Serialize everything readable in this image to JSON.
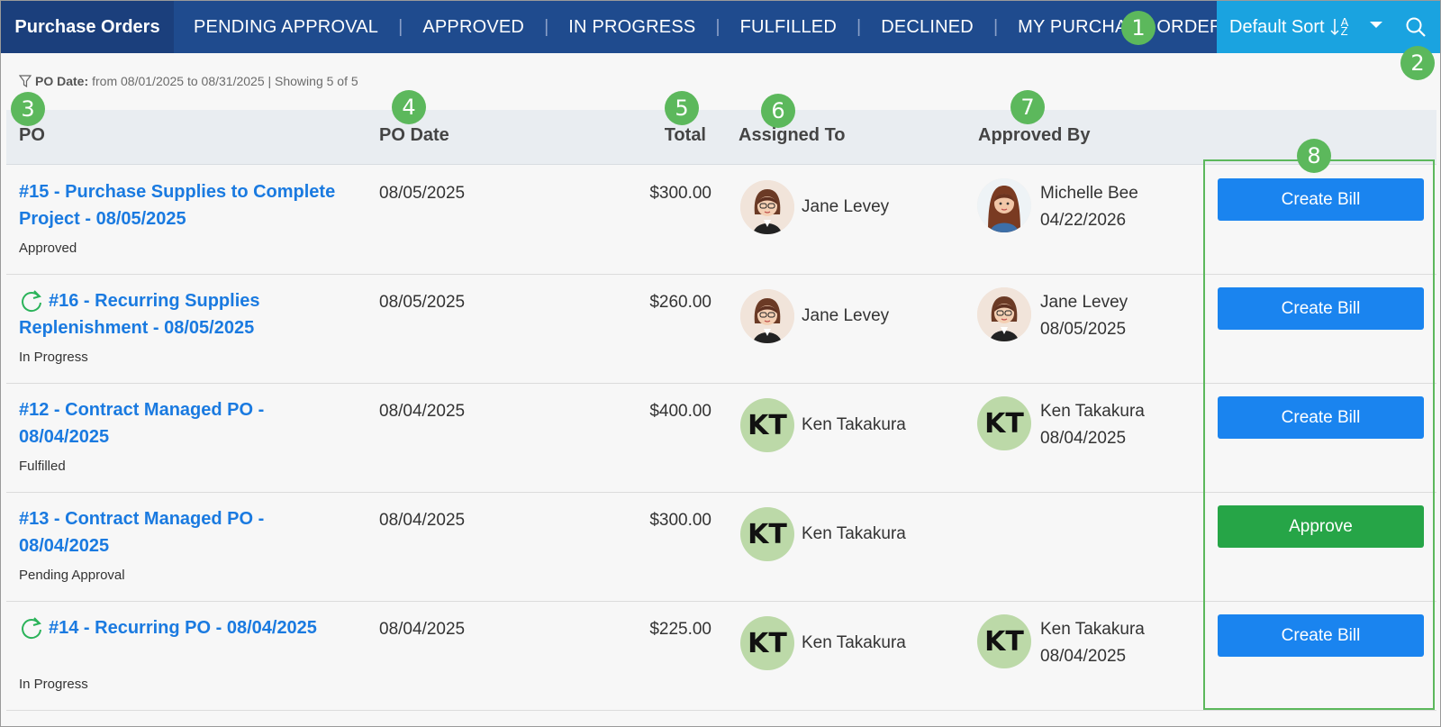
{
  "nav": {
    "active_tab": "Purchase Orders",
    "tabs": [
      "PENDING APPROVAL",
      "APPROVED",
      "IN PROGRESS",
      "FULFILLED",
      "DECLINED",
      "MY PURCHASE ORDERS"
    ],
    "separator": "|",
    "sort_label": "Default Sort",
    "sort_az_top": "A",
    "sort_az_bottom": "Z",
    "colors": {
      "nav_bg": "#1f4b8e",
      "active_bg": "#1b3f7c",
      "sort_bg": "#1aa3e0"
    }
  },
  "filter": {
    "label": "PO Date:",
    "text": "from 08/01/2025 to 08/31/2025 | Showing 5 of 5"
  },
  "columns": {
    "po": "PO",
    "po_date": "PO Date",
    "total": "Total",
    "assigned_to": "Assigned To",
    "approved_by": "Approved By"
  },
  "rows": [
    {
      "title": "#15 - Purchase Supplies to Complete Project - 08/05/2025",
      "recurring": false,
      "status": "Approved",
      "date": "08/05/2025",
      "total": "$300.00",
      "assigned": {
        "name": "Jane Levey",
        "initials": "",
        "avatar": "photo-jane"
      },
      "approved": {
        "name": "Michelle Bee",
        "date": "04/22/2026",
        "initials": "",
        "avatar": "photo-michelle"
      },
      "action": "Create Bill",
      "action_color": "#1a84ef"
    },
    {
      "title": "#16 - Recurring Supplies Replenishment - 08/05/2025",
      "recurring": true,
      "status": "In Progress",
      "date": "08/05/2025",
      "total": "$260.00",
      "assigned": {
        "name": "Jane Levey",
        "initials": "",
        "avatar": "photo-jane"
      },
      "approved": {
        "name": "Jane Levey",
        "date": "08/05/2025",
        "initials": "",
        "avatar": "photo-jane"
      },
      "action": "Create Bill",
      "action_color": "#1a84ef"
    },
    {
      "title": "#12 - Contract Managed PO - 08/04/2025",
      "recurring": false,
      "status": "Fulfilled",
      "date": "08/04/2025",
      "total": "$400.00",
      "assigned": {
        "name": "Ken Takakura",
        "initials": "KT",
        "avatar": "initials"
      },
      "approved": {
        "name": "Ken Takakura",
        "date": "08/04/2025",
        "initials": "KT",
        "avatar": "initials"
      },
      "action": "Create Bill",
      "action_color": "#1a84ef"
    },
    {
      "title": "#13 - Contract Managed PO - 08/04/2025",
      "recurring": false,
      "status": "Pending Approval",
      "date": "08/04/2025",
      "total": "$300.00",
      "assigned": {
        "name": "Ken Takakura",
        "initials": "KT",
        "avatar": "initials"
      },
      "approved": null,
      "action": "Approve",
      "action_color": "#26a547"
    },
    {
      "title": "#14 - Recurring PO - 08/04/2025",
      "recurring": true,
      "status": "In Progress",
      "date": "08/04/2025",
      "total": "$225.00",
      "assigned": {
        "name": "Ken Takakura",
        "initials": "KT",
        "avatar": "initials"
      },
      "approved": {
        "name": "Ken Takakura",
        "date": "08/04/2025",
        "initials": "KT",
        "avatar": "initials"
      },
      "action": "Create Bill",
      "action_color": "#1a84ef"
    }
  ],
  "callouts": [
    "1",
    "2",
    "3",
    "4",
    "5",
    "6",
    "7",
    "8"
  ]
}
